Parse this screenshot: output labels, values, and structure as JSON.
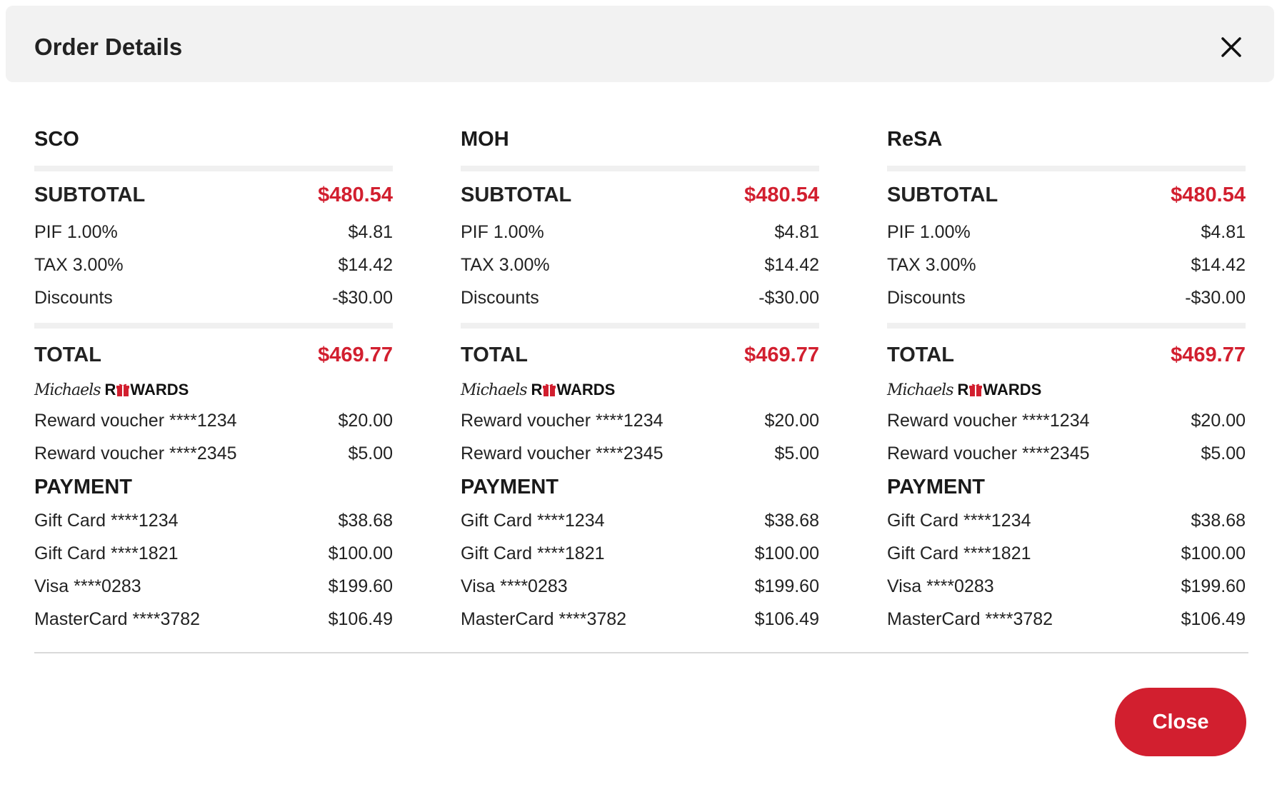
{
  "modal": {
    "title": "Order Details",
    "close_button_label": "Close",
    "accent_color": "#d21f2f"
  },
  "columns": [
    {
      "title": "SCO",
      "subtotal_label": "SUBTOTAL",
      "subtotal_value": "$480.54",
      "lines": [
        {
          "label": "PIF 1.00%",
          "value": "$4.81"
        },
        {
          "label": "TAX 3.00%",
          "value": "$14.42"
        },
        {
          "label": "Discounts",
          "value": "-$30.00"
        }
      ],
      "total_label": "TOTAL",
      "total_value": "$469.77",
      "rewards_logo_script": "Michaels",
      "rewards_logo_word_start": "R",
      "rewards_logo_word_end": "WARDS",
      "vouchers": [
        {
          "label": "Reward voucher ****1234",
          "value": "$20.00"
        },
        {
          "label": "Reward voucher ****2345",
          "value": "$5.00"
        }
      ],
      "payment_label": "PAYMENT",
      "payments": [
        {
          "label": "Gift Card ****1234",
          "value": "$38.68"
        },
        {
          "label": "Gift Card ****1821",
          "value": "$100.00"
        },
        {
          "label": "Visa ****0283",
          "value": "$199.60"
        },
        {
          "label": "MasterCard ****3782",
          "value": "$106.49"
        }
      ]
    },
    {
      "title": "MOH",
      "subtotal_label": "SUBTOTAL",
      "subtotal_value": "$480.54",
      "lines": [
        {
          "label": "PIF 1.00%",
          "value": "$4.81"
        },
        {
          "label": "TAX 3.00%",
          "value": "$14.42"
        },
        {
          "label": "Discounts",
          "value": "-$30.00"
        }
      ],
      "total_label": "TOTAL",
      "total_value": "$469.77",
      "rewards_logo_script": "Michaels",
      "rewards_logo_word_start": "R",
      "rewards_logo_word_end": "WARDS",
      "vouchers": [
        {
          "label": "Reward voucher ****1234",
          "value": "$20.00"
        },
        {
          "label": "Reward voucher ****2345",
          "value": "$5.00"
        }
      ],
      "payment_label": "PAYMENT",
      "payments": [
        {
          "label": "Gift Card ****1234",
          "value": "$38.68"
        },
        {
          "label": "Gift Card ****1821",
          "value": "$100.00"
        },
        {
          "label": "Visa ****0283",
          "value": "$199.60"
        },
        {
          "label": "MasterCard ****3782",
          "value": "$106.49"
        }
      ]
    },
    {
      "title": "ReSA",
      "subtotal_label": "SUBTOTAL",
      "subtotal_value": "$480.54",
      "lines": [
        {
          "label": "PIF 1.00%",
          "value": "$4.81"
        },
        {
          "label": "TAX 3.00%",
          "value": "$14.42"
        },
        {
          "label": "Discounts",
          "value": "-$30.00"
        }
      ],
      "total_label": "TOTAL",
      "total_value": "$469.77",
      "rewards_logo_script": "Michaels",
      "rewards_logo_word_start": "R",
      "rewards_logo_word_end": "WARDS",
      "vouchers": [
        {
          "label": "Reward voucher ****1234",
          "value": "$20.00"
        },
        {
          "label": "Reward voucher ****2345",
          "value": "$5.00"
        }
      ],
      "payment_label": "PAYMENT",
      "payments": [
        {
          "label": "Gift Card ****1234",
          "value": "$38.68"
        },
        {
          "label": "Gift Card ****1821",
          "value": "$100.00"
        },
        {
          "label": "Visa ****0283",
          "value": "$199.60"
        },
        {
          "label": "MasterCard ****3782",
          "value": "$106.49"
        }
      ]
    }
  ]
}
